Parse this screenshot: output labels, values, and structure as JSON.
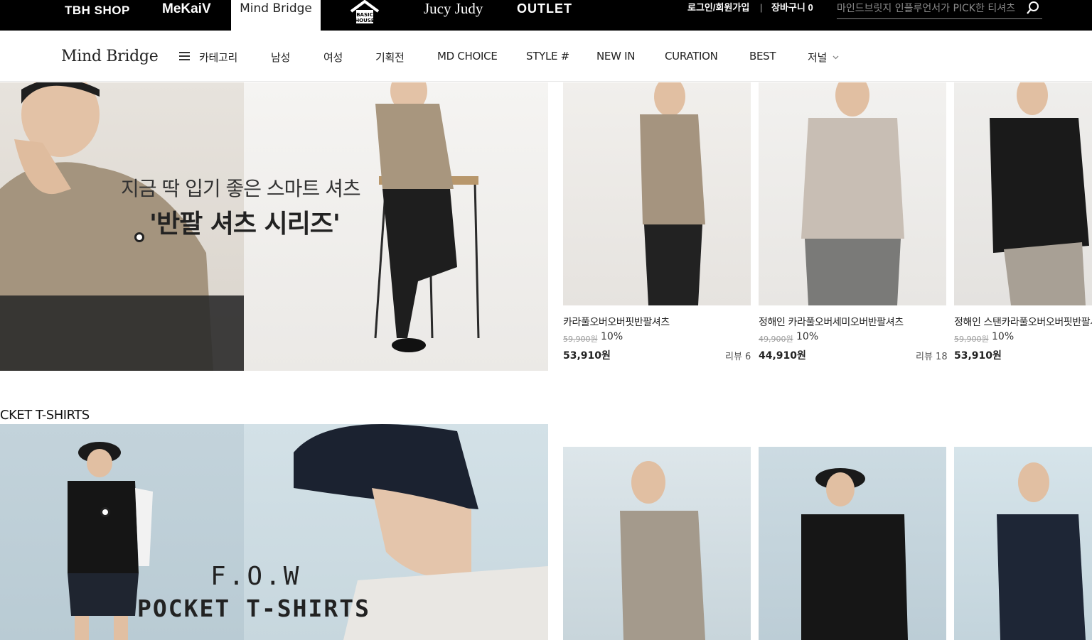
{
  "topbar": {
    "brands": [
      "TBH SHOP",
      "MeKaiV",
      "Mind Bridge",
      "BASIC HOUSE",
      "Jucy Judy",
      "OUTLET"
    ],
    "login_label": "로그인/회원가입",
    "separator": "|",
    "cart_label": "장바구니 0",
    "search_placeholder": "마인드브릿지 인플루언서가 PICK한 티셔츠"
  },
  "gnb": {
    "logo": "Mind Bridge",
    "category_label": "카테고리",
    "nav": [
      "남성",
      "여성",
      "기획전",
      "MD CHOICE",
      "STYLE #",
      "NEW IN",
      "CURATION",
      "BEST",
      "저널"
    ]
  },
  "banner1": {
    "subtitle": "지금 딱 입기 좋은 스마트 셔츠",
    "title": "'반팔 셔츠 시리즈'"
  },
  "section2": {
    "title": "CKET T-SHIRTS",
    "banner_subtitle": "F.O.W",
    "banner_title": "POCKET T-SHIRTS"
  },
  "products_row1": [
    {
      "name": "카라풀오버오버핏반팔셔츠",
      "original_price": "59,900원",
      "discount": "10%",
      "price": "53,910원",
      "review": "리뷰 6"
    },
    {
      "name": "정해인 카라풀오버세미오버반팔셔츠",
      "original_price": "49,900원",
      "discount": "10%",
      "price": "44,910원",
      "review": "리뷰 18"
    },
    {
      "name": "정해인 스탠카라풀오버오버핏반팔셔츠",
      "original_price": "59,900원",
      "discount": "10%",
      "price": "53,910원",
      "review": ""
    }
  ],
  "colors": {
    "topbar_bg": "#000000",
    "text": "#222222"
  }
}
